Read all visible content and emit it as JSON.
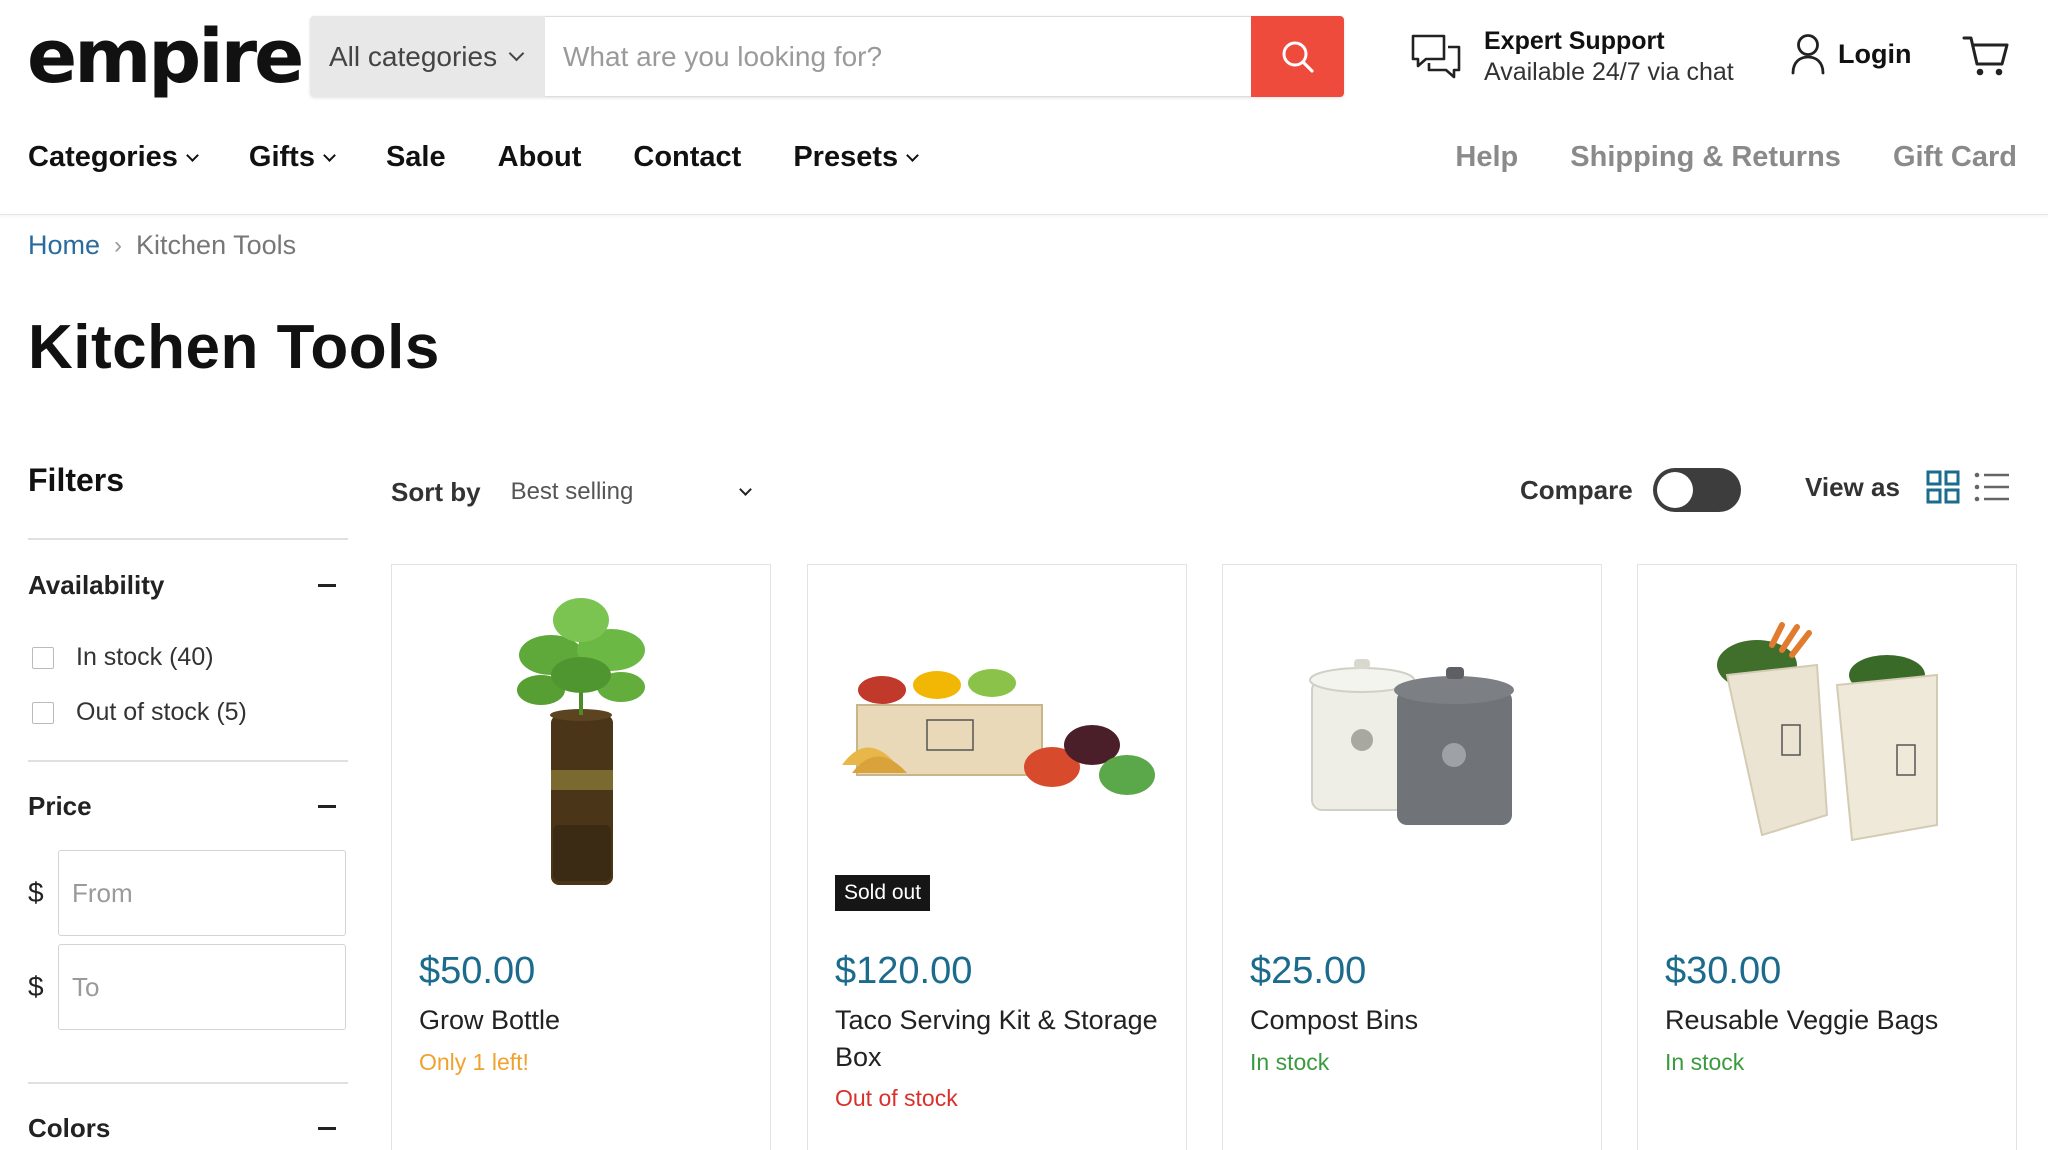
{
  "header": {
    "logo": "empire",
    "search": {
      "category": "All categories",
      "placeholder": "What are you looking for?"
    },
    "support": {
      "title": "Expert Support",
      "subtitle": "Available 24/7 via chat"
    },
    "login_label": "Login"
  },
  "nav": {
    "main": [
      "Categories",
      "Gifts",
      "Sale",
      "About",
      "Contact",
      "Presets"
    ],
    "secondary": [
      "Help",
      "Shipping & Returns",
      "Gift Card"
    ]
  },
  "breadcrumb": {
    "home": "Home",
    "current": "Kitchen Tools"
  },
  "page_title": "Kitchen Tools",
  "filters": {
    "title": "Filters",
    "availability": {
      "label": "Availability",
      "options": [
        "In stock (40)",
        "Out of stock (5)"
      ]
    },
    "price": {
      "label": "Price",
      "currency": "$",
      "from_placeholder": "From",
      "to_placeholder": "To"
    },
    "colors": {
      "label": "Colors"
    }
  },
  "toolbar": {
    "sort_label": "Sort by",
    "sort_value": "Best selling",
    "compare_label": "Compare",
    "view_label": "View as"
  },
  "products": [
    {
      "price": "$50.00",
      "name": "Grow Bottle",
      "stock": "Only 1 left!",
      "stock_color": "#f0a22e",
      "badge": ""
    },
    {
      "price": "$120.00",
      "name": "Taco Serving Kit & Storage Box",
      "stock": "Out of stock",
      "stock_color": "#d9302b",
      "badge": "Sold out"
    },
    {
      "price": "$25.00",
      "name": "Compost Bins",
      "stock": "In stock",
      "stock_color": "#3a9a3f",
      "badge": ""
    },
    {
      "price": "$30.00",
      "name": "Reusable Veggie Bags",
      "stock": "In stock",
      "stock_color": "#3a9a3f",
      "badge": ""
    }
  ],
  "colors": {
    "accent": "#ef4b3c",
    "price": "#1b6b8c",
    "link": "#2a6b9e"
  }
}
